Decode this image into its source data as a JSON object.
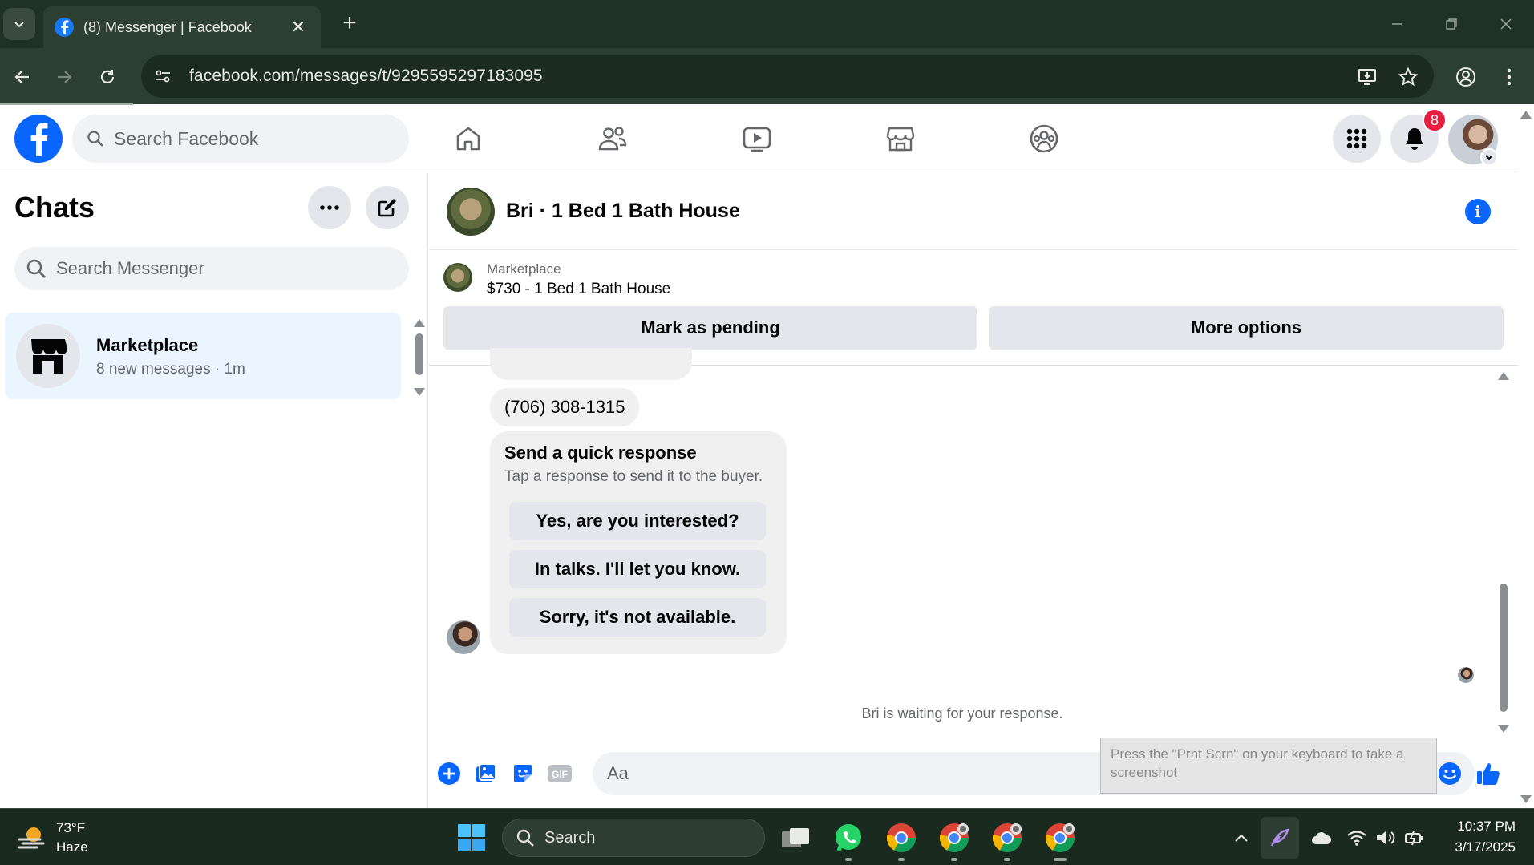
{
  "browser": {
    "tab_title": "(8) Messenger | Facebook",
    "url": "facebook.com/messages/t/9295595297183095"
  },
  "header": {
    "search_placeholder": "Search Facebook",
    "notification_count": "8",
    "icons": [
      "facebook-logo-icon",
      "home-icon",
      "friends-icon",
      "video-icon",
      "marketplace-icon",
      "groups-icon",
      "menu-grid-icon",
      "bell-icon"
    ]
  },
  "sidebar": {
    "title": "Chats",
    "search_placeholder": "Search Messenger",
    "chats": [
      {
        "name": "Marketplace",
        "subtitle": "8 new messages · 1m"
      }
    ]
  },
  "conversation": {
    "title": "Bri · 1 Bed 1 Bath House",
    "listing": {
      "category": "Marketplace",
      "title": "$730 - 1 Bed 1 Bath House",
      "mark_pending_label": "Mark as pending",
      "more_options_label": "More options"
    },
    "messages": {
      "phone": "(706) 308-1315",
      "quick_response": {
        "title": "Send a quick response",
        "subtitle": "Tap a response to send it to the buyer.",
        "options": [
          "Yes, are you interested?",
          "In talks. I'll let you know.",
          "Sorry, it's not available."
        ]
      }
    },
    "waiting_text": "Bri is waiting for your response.",
    "composer_placeholder": "Aa"
  },
  "tooltip": "Press the \"Prnt Scrn\" on your keyboard to take a screenshot",
  "taskbar": {
    "weather_temp": "73°F",
    "weather_desc": "Haze",
    "search_placeholder": "Search",
    "time": "10:37 PM",
    "date": "3/17/2025"
  },
  "colors": {
    "facebook_blue": "#0866ff",
    "badge_red": "#e41e3f",
    "selected_chat_bg": "#ebf5ff",
    "browser_frame": "#2d3f31"
  }
}
